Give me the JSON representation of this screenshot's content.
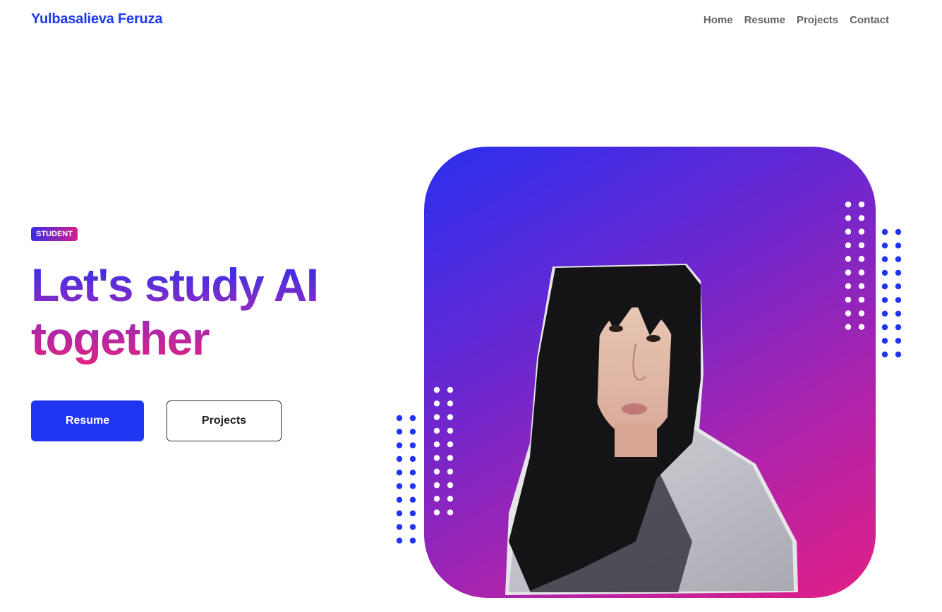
{
  "header": {
    "brand": "Yulbasalieva Feruza",
    "nav": [
      "Home",
      "Resume",
      "Projects",
      "Contact"
    ]
  },
  "hero": {
    "badge": "STUDENT",
    "headline_line1": "Let's study AI",
    "headline_line2": "together",
    "primary_button": "Resume",
    "secondary_button": "Projects"
  },
  "colors": {
    "brand": "#1f3aed",
    "primary_button": "#1f35f2",
    "gradient_start": "#2631ee",
    "gradient_end": "#e1237f",
    "dot_blue": "#1f35f2",
    "dot_white": "#ffffff"
  },
  "decor": {
    "portrait": "portrait-photo",
    "dot_grids": [
      "dots-white-right",
      "dots-blue-right",
      "dots-white-left",
      "dots-blue-left"
    ]
  }
}
